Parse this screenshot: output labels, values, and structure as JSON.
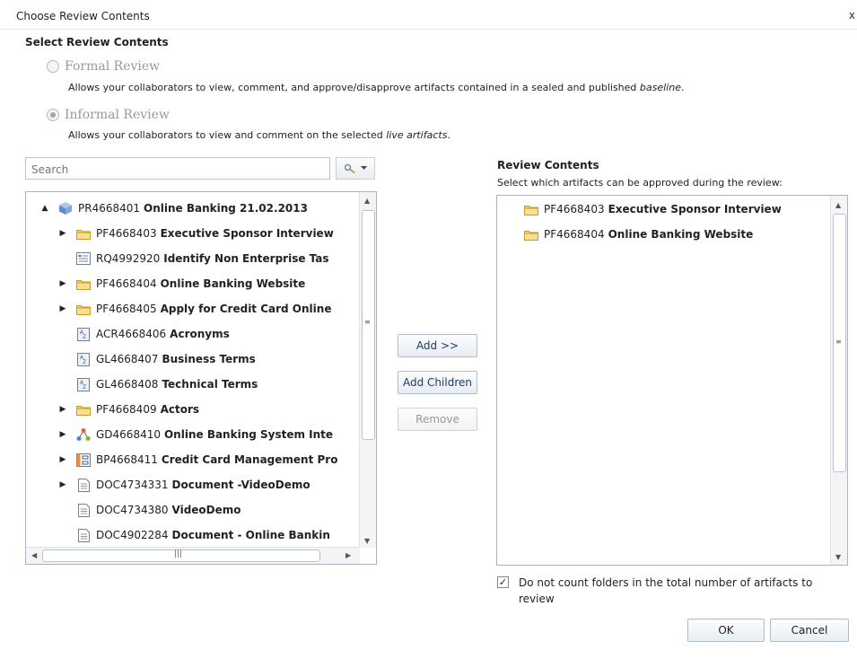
{
  "window": {
    "title": "Choose Review Contents",
    "close_glyph": "x"
  },
  "section_title": "Select Review Contents",
  "options": [
    {
      "label": "Formal Review",
      "checked": false,
      "desc_prefix": "Allows your collaborators to view, comment, and approve/disapprove artifacts contained in a sealed and published ",
      "desc_em": "baseline",
      "desc_suffix": "."
    },
    {
      "label": "Informal Review",
      "checked": true,
      "desc_prefix": "Allows your collaborators to view and comment on the selected ",
      "desc_em": "live artifacts",
      "desc_suffix": "."
    }
  ],
  "search": {
    "placeholder": "Search"
  },
  "tree": [
    {
      "id": "PR4668401",
      "name": "Online Banking 21.02.2013",
      "icon": "project-cube-icon",
      "expander": "▲"
    },
    {
      "id": "PF4668403",
      "name": "Executive Sponsor Interview",
      "icon": "folder-icon",
      "expander": "▶"
    },
    {
      "id": "RQ4992920",
      "name": "Identify Non Enterprise Tas",
      "icon": "requirement-icon",
      "expander": ""
    },
    {
      "id": "PF4668404",
      "name": "Online Banking Website",
      "icon": "folder-icon",
      "expander": "▶"
    },
    {
      "id": "PF4668405",
      "name": "Apply for Credit Card Online",
      "icon": "folder-icon",
      "expander": "▶"
    },
    {
      "id": "ACR4668406",
      "name": "Acronyms",
      "icon": "glossary-icon",
      "expander": ""
    },
    {
      "id": "GL4668407",
      "name": "Business Terms",
      "icon": "glossary-icon",
      "expander": ""
    },
    {
      "id": "GL4668408",
      "name": "Technical Terms",
      "icon": "glossary-icon",
      "expander": ""
    },
    {
      "id": "PF4668409",
      "name": "Actors",
      "icon": "folder-icon",
      "expander": "▶"
    },
    {
      "id": "GD4668410",
      "name": "Online Banking System Inte",
      "icon": "graphical-diagram-icon",
      "expander": "▶"
    },
    {
      "id": "BP4668411",
      "name": "Credit Card Management Pro",
      "icon": "business-process-icon",
      "expander": "▶"
    },
    {
      "id": "DOC4734331",
      "name": "Document -VideoDemo",
      "icon": "document-icon",
      "expander": "▶"
    },
    {
      "id": "DOC4734380",
      "name": "VideoDemo",
      "icon": "document-icon",
      "expander": ""
    },
    {
      "id": "DOC4902284",
      "name": "Document - Online Bankin",
      "icon": "document-icon",
      "expander": ""
    }
  ],
  "buttons": {
    "add": "Add >>",
    "add_children": "Add Children",
    "remove": "Remove",
    "ok": "OK",
    "cancel": "Cancel"
  },
  "review_contents": {
    "title": "Review Contents",
    "subtitle": "Select which artifacts can be approved during the review:",
    "items": [
      {
        "id": "PF4668403",
        "name": "Executive Sponsor Interview",
        "icon": "folder-icon"
      },
      {
        "id": "PF4668404",
        "name": "Online Banking Website",
        "icon": "folder-icon"
      }
    ]
  },
  "folders_checkbox": {
    "label": "Do not count folders in the total number of artifacts to review",
    "checked": true
  }
}
